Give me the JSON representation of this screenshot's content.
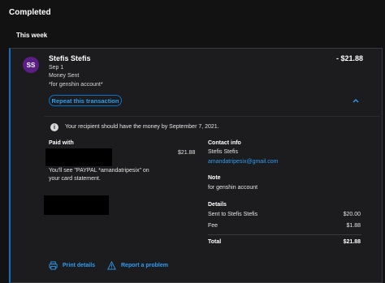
{
  "section": {
    "title": "Completed",
    "week_label": "This week"
  },
  "transaction": {
    "avatar_initials": "SS",
    "name": "Stefis Stefis",
    "amount": "- $21.88",
    "date": "Sep 1",
    "type": "Money Sent",
    "note": "*for genshin account*",
    "repeat_label": "Repeat this transaction",
    "expected_text": "Your recipient should have the money by September 7, 2021."
  },
  "paid_with": {
    "label": "Paid with",
    "amount": "$21.88",
    "statement_text": "You'll see \"PAYPAL *amandatripesix\" on your card statement."
  },
  "contact": {
    "label": "Contact info",
    "name": "Stefis Stefis",
    "email": "amandatripesix@gmail.com"
  },
  "note_section": {
    "label": "Note",
    "value": "for genshin account"
  },
  "details": {
    "label": "Details",
    "sent_label": "Sent to Stefis Stefis",
    "sent_value": "$20.00",
    "fee_label": "Fee",
    "fee_value": "$1.88",
    "total_label": "Total",
    "total_value": "$21.88"
  },
  "actions": {
    "print_label": "Print details",
    "report_label": "Report a problem"
  },
  "colors": {
    "accent": "#2e9df4",
    "border_accent": "#0a72c4",
    "avatar": "#5a1e86",
    "background": "#121212"
  },
  "icons": [
    "info-icon",
    "chevron-up-icon",
    "printer-icon",
    "warning-icon"
  ]
}
